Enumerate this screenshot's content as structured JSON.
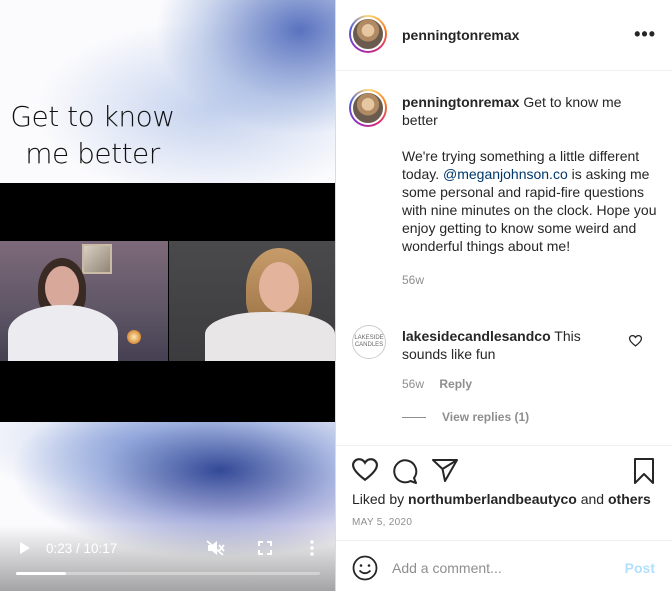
{
  "video": {
    "overlay_text_line1": "Get to know",
    "overlay_text_line2": "me better",
    "time": "0:23 / 10:17",
    "progress_fraction": 0.037,
    "icons": {
      "play": "play-icon",
      "mute": "muted-speaker-icon",
      "fullscreen": "fullscreen-icon",
      "more": "vertical-dots-icon"
    }
  },
  "header": {
    "username": "penningtonremax",
    "more_label": "•••"
  },
  "caption": {
    "username": "penningtonremax",
    "title": "Get to know me better",
    "body_before": "We're trying something a little different today. ",
    "mention": "@meganjohnson.co",
    "body_after": " is asking me some personal and rapid-fire questions with nine minutes on the clock. Hope you enjoy getting to know some weird and wonderful things about me!",
    "timestamp": "56w"
  },
  "comment": {
    "username": "lakesidecandlesandco",
    "text": "This sounds like fun",
    "timestamp": "56w",
    "reply_label": "Reply",
    "view_replies": "View replies (1)",
    "avatar_text": "LAKESIDE CANDLES"
  },
  "actions": {
    "liked_prefix": "Liked by ",
    "liked_user": "northumberlandbeautyco",
    "liked_mid": " and ",
    "liked_others": "others",
    "date": "MAY 5, 2020"
  },
  "add_comment": {
    "placeholder": "Add a comment...",
    "post_label": "Post"
  },
  "colors": {
    "link": "#00376b",
    "muted": "#8e8e8e",
    "post_disabled": "#b2dffc"
  }
}
